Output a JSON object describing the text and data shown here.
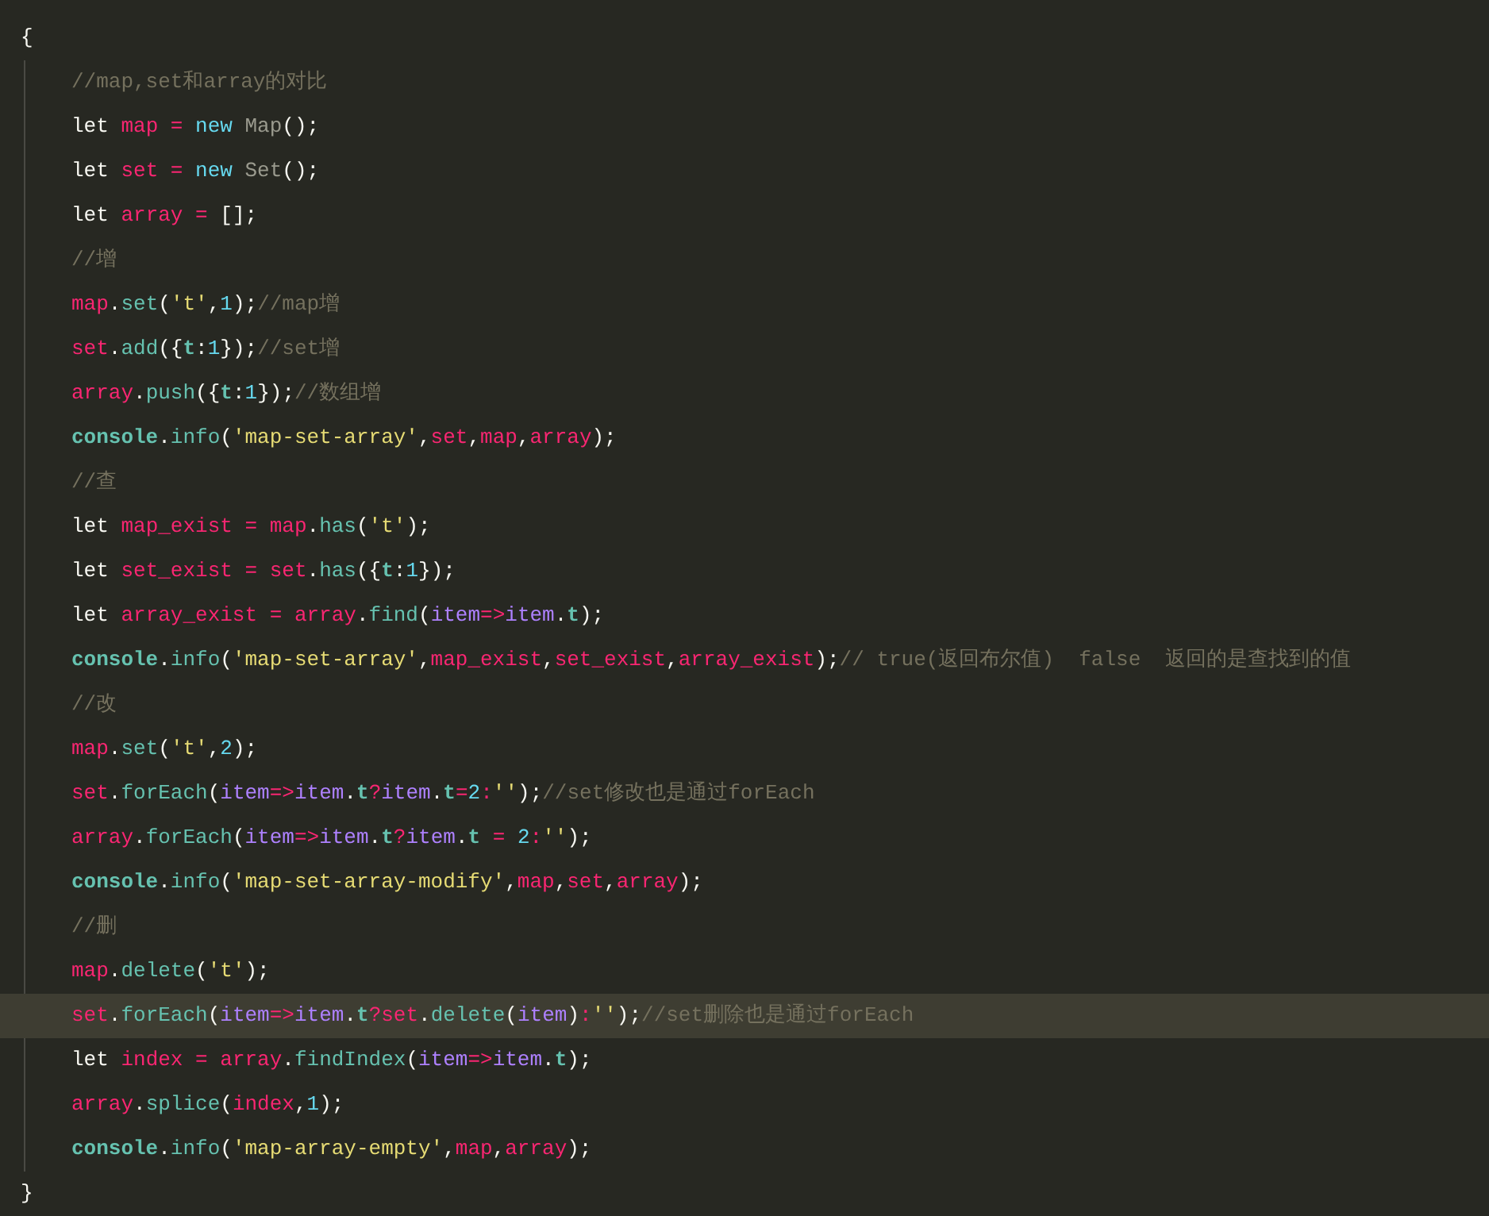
{
  "editor": {
    "lines": [
      {
        "current": false,
        "tokens": [
          {
            "kind": "plain",
            "text": "{"
          }
        ],
        "children": [
          {
            "current": false,
            "tokens": [
              {
                "kind": "comment",
                "text": "//map,set和array的对比"
              }
            ]
          },
          {
            "current": false,
            "tokens": [
              {
                "kind": "plain",
                "text": "let "
              },
              {
                "kind": "var",
                "text": "map"
              },
              {
                "kind": "op",
                "text": " = "
              },
              {
                "kind": "kw",
                "text": "new "
              },
              {
                "kind": "cls",
                "text": "Map"
              },
              {
                "kind": "plain",
                "text": "();"
              }
            ]
          },
          {
            "current": false,
            "tokens": [
              {
                "kind": "plain",
                "text": "let "
              },
              {
                "kind": "var",
                "text": "set"
              },
              {
                "kind": "op",
                "text": " = "
              },
              {
                "kind": "kw",
                "text": "new "
              },
              {
                "kind": "cls",
                "text": "Set"
              },
              {
                "kind": "plain",
                "text": "();"
              }
            ]
          },
          {
            "current": false,
            "tokens": [
              {
                "kind": "plain",
                "text": "let "
              },
              {
                "kind": "var",
                "text": "array"
              },
              {
                "kind": "op",
                "text": " = "
              },
              {
                "kind": "plain",
                "text": "[];"
              }
            ]
          },
          {
            "current": false,
            "tokens": [
              {
                "kind": "comment",
                "text": "//增"
              }
            ]
          },
          {
            "current": false,
            "tokens": [
              {
                "kind": "var",
                "text": "map"
              },
              {
                "kind": "plain",
                "text": "."
              },
              {
                "kind": "fn",
                "text": "set"
              },
              {
                "kind": "plain",
                "text": "("
              },
              {
                "kind": "str",
                "text": "'t'"
              },
              {
                "kind": "plain",
                "text": ","
              },
              {
                "kind": "num",
                "text": "1"
              },
              {
                "kind": "plain",
                "text": ");"
              },
              {
                "kind": "comment",
                "text": "//map增"
              }
            ]
          },
          {
            "current": false,
            "tokens": [
              {
                "kind": "var",
                "text": "set"
              },
              {
                "kind": "plain",
                "text": "."
              },
              {
                "kind": "fn",
                "text": "add"
              },
              {
                "kind": "plain",
                "text": "({"
              },
              {
                "kind": "key",
                "text": "t"
              },
              {
                "kind": "plain",
                "text": ":"
              },
              {
                "kind": "num",
                "text": "1"
              },
              {
                "kind": "plain",
                "text": "});"
              },
              {
                "kind": "comment",
                "text": "//set增"
              }
            ]
          },
          {
            "current": false,
            "tokens": [
              {
                "kind": "var",
                "text": "array"
              },
              {
                "kind": "plain",
                "text": "."
              },
              {
                "kind": "fn",
                "text": "push"
              },
              {
                "kind": "plain",
                "text": "({"
              },
              {
                "kind": "key",
                "text": "t"
              },
              {
                "kind": "plain",
                "text": ":"
              },
              {
                "kind": "num",
                "text": "1"
              },
              {
                "kind": "plain",
                "text": "});"
              },
              {
                "kind": "comment",
                "text": "//数组增"
              }
            ]
          },
          {
            "current": false,
            "tokens": [
              {
                "kind": "key",
                "text": "console"
              },
              {
                "kind": "plain",
                "text": "."
              },
              {
                "kind": "fn",
                "text": "info"
              },
              {
                "kind": "plain",
                "text": "("
              },
              {
                "kind": "str",
                "text": "'map-set-array'"
              },
              {
                "kind": "plain",
                "text": ","
              },
              {
                "kind": "var",
                "text": "set"
              },
              {
                "kind": "plain",
                "text": ","
              },
              {
                "kind": "var",
                "text": "map"
              },
              {
                "kind": "plain",
                "text": ","
              },
              {
                "kind": "var",
                "text": "array"
              },
              {
                "kind": "plain",
                "text": ");"
              }
            ]
          },
          {
            "current": false,
            "tokens": [
              {
                "kind": "comment",
                "text": "//查"
              }
            ]
          },
          {
            "current": false,
            "tokens": [
              {
                "kind": "plain",
                "text": "let "
              },
              {
                "kind": "var",
                "text": "map_exist"
              },
              {
                "kind": "op",
                "text": " = "
              },
              {
                "kind": "var",
                "text": "map"
              },
              {
                "kind": "plain",
                "text": "."
              },
              {
                "kind": "fn",
                "text": "has"
              },
              {
                "kind": "plain",
                "text": "("
              },
              {
                "kind": "str",
                "text": "'t'"
              },
              {
                "kind": "plain",
                "text": ");"
              }
            ]
          },
          {
            "current": false,
            "tokens": [
              {
                "kind": "plain",
                "text": "let "
              },
              {
                "kind": "var",
                "text": "set_exist"
              },
              {
                "kind": "op",
                "text": " = "
              },
              {
                "kind": "var",
                "text": "set"
              },
              {
                "kind": "plain",
                "text": "."
              },
              {
                "kind": "fn",
                "text": "has"
              },
              {
                "kind": "plain",
                "text": "({"
              },
              {
                "kind": "key",
                "text": "t"
              },
              {
                "kind": "plain",
                "text": ":"
              },
              {
                "kind": "num",
                "text": "1"
              },
              {
                "kind": "plain",
                "text": "});"
              }
            ]
          },
          {
            "current": false,
            "tokens": [
              {
                "kind": "plain",
                "text": "let "
              },
              {
                "kind": "var",
                "text": "array_exist"
              },
              {
                "kind": "op",
                "text": " = "
              },
              {
                "kind": "var",
                "text": "array"
              },
              {
                "kind": "plain",
                "text": "."
              },
              {
                "kind": "fn",
                "text": "find"
              },
              {
                "kind": "plain",
                "text": "("
              },
              {
                "kind": "prop",
                "text": "item"
              },
              {
                "kind": "op",
                "text": "=>"
              },
              {
                "kind": "prop",
                "text": "item"
              },
              {
                "kind": "plain",
                "text": "."
              },
              {
                "kind": "key",
                "text": "t"
              },
              {
                "kind": "plain",
                "text": ");"
              }
            ]
          },
          {
            "current": false,
            "tokens": [
              {
                "kind": "key",
                "text": "console"
              },
              {
                "kind": "plain",
                "text": "."
              },
              {
                "kind": "fn",
                "text": "info"
              },
              {
                "kind": "plain",
                "text": "("
              },
              {
                "kind": "str",
                "text": "'map-set-array'"
              },
              {
                "kind": "plain",
                "text": ","
              },
              {
                "kind": "var",
                "text": "map_exist"
              },
              {
                "kind": "plain",
                "text": ","
              },
              {
                "kind": "var",
                "text": "set_exist"
              },
              {
                "kind": "plain",
                "text": ","
              },
              {
                "kind": "var",
                "text": "array_exist"
              },
              {
                "kind": "plain",
                "text": ");"
              },
              {
                "kind": "comment",
                "text": "// true(返回布尔值)  false  返回的是查找到的值"
              }
            ]
          },
          {
            "current": false,
            "tokens": [
              {
                "kind": "comment",
                "text": "//改"
              }
            ]
          },
          {
            "current": false,
            "tokens": [
              {
                "kind": "var",
                "text": "map"
              },
              {
                "kind": "plain",
                "text": "."
              },
              {
                "kind": "fn",
                "text": "set"
              },
              {
                "kind": "plain",
                "text": "("
              },
              {
                "kind": "str",
                "text": "'t'"
              },
              {
                "kind": "plain",
                "text": ","
              },
              {
                "kind": "num",
                "text": "2"
              },
              {
                "kind": "plain",
                "text": ");"
              }
            ]
          },
          {
            "current": false,
            "tokens": [
              {
                "kind": "var",
                "text": "set"
              },
              {
                "kind": "plain",
                "text": "."
              },
              {
                "kind": "fn",
                "text": "forEach"
              },
              {
                "kind": "plain",
                "text": "("
              },
              {
                "kind": "prop",
                "text": "item"
              },
              {
                "kind": "op",
                "text": "=>"
              },
              {
                "kind": "prop",
                "text": "item"
              },
              {
                "kind": "plain",
                "text": "."
              },
              {
                "kind": "key",
                "text": "t"
              },
              {
                "kind": "op",
                "text": "?"
              },
              {
                "kind": "prop",
                "text": "item"
              },
              {
                "kind": "plain",
                "text": "."
              },
              {
                "kind": "key",
                "text": "t"
              },
              {
                "kind": "op",
                "text": "="
              },
              {
                "kind": "num",
                "text": "2"
              },
              {
                "kind": "op",
                "text": ":"
              },
              {
                "kind": "str",
                "text": "''"
              },
              {
                "kind": "plain",
                "text": ");"
              },
              {
                "kind": "comment",
                "text": "//set修改也是通过forEach"
              }
            ]
          },
          {
            "current": false,
            "tokens": [
              {
                "kind": "var",
                "text": "array"
              },
              {
                "kind": "plain",
                "text": "."
              },
              {
                "kind": "fn",
                "text": "forEach"
              },
              {
                "kind": "plain",
                "text": "("
              },
              {
                "kind": "prop",
                "text": "item"
              },
              {
                "kind": "op",
                "text": "=>"
              },
              {
                "kind": "prop",
                "text": "item"
              },
              {
                "kind": "plain",
                "text": "."
              },
              {
                "kind": "key",
                "text": "t"
              },
              {
                "kind": "op",
                "text": "?"
              },
              {
                "kind": "prop",
                "text": "item"
              },
              {
                "kind": "plain",
                "text": "."
              },
              {
                "kind": "key",
                "text": "t"
              },
              {
                "kind": "op",
                "text": " = "
              },
              {
                "kind": "num",
                "text": "2"
              },
              {
                "kind": "op",
                "text": ":"
              },
              {
                "kind": "str",
                "text": "''"
              },
              {
                "kind": "plain",
                "text": ");"
              }
            ]
          },
          {
            "current": false,
            "tokens": [
              {
                "kind": "key",
                "text": "console"
              },
              {
                "kind": "plain",
                "text": "."
              },
              {
                "kind": "fn",
                "text": "info"
              },
              {
                "kind": "plain",
                "text": "("
              },
              {
                "kind": "str",
                "text": "'map-set-array-modify'"
              },
              {
                "kind": "plain",
                "text": ","
              },
              {
                "kind": "var",
                "text": "map"
              },
              {
                "kind": "plain",
                "text": ","
              },
              {
                "kind": "var",
                "text": "set"
              },
              {
                "kind": "plain",
                "text": ","
              },
              {
                "kind": "var",
                "text": "array"
              },
              {
                "kind": "plain",
                "text": ");"
              }
            ]
          },
          {
            "current": false,
            "tokens": [
              {
                "kind": "comment",
                "text": "//删"
              }
            ]
          },
          {
            "current": false,
            "tokens": [
              {
                "kind": "var",
                "text": "map"
              },
              {
                "kind": "plain",
                "text": "."
              },
              {
                "kind": "fn",
                "text": "delete"
              },
              {
                "kind": "plain",
                "text": "("
              },
              {
                "kind": "str",
                "text": "'t'"
              },
              {
                "kind": "plain",
                "text": ");"
              }
            ]
          },
          {
            "current": true,
            "tokens": [
              {
                "kind": "var",
                "text": "set"
              },
              {
                "kind": "plain",
                "text": "."
              },
              {
                "kind": "fn",
                "text": "forEach"
              },
              {
                "kind": "plain",
                "text": "("
              },
              {
                "kind": "prop",
                "text": "item"
              },
              {
                "kind": "op",
                "text": "=>"
              },
              {
                "kind": "prop",
                "text": "item"
              },
              {
                "kind": "plain",
                "text": "."
              },
              {
                "kind": "key",
                "text": "t"
              },
              {
                "kind": "op",
                "text": "?"
              },
              {
                "kind": "var",
                "text": "set"
              },
              {
                "kind": "plain",
                "text": "."
              },
              {
                "kind": "fn",
                "text": "delete"
              },
              {
                "kind": "plain",
                "text": "("
              },
              {
                "kind": "prop",
                "text": "item"
              },
              {
                "kind": "plain",
                "text": ")"
              },
              {
                "kind": "op",
                "text": ":"
              },
              {
                "kind": "str",
                "text": "''"
              },
              {
                "kind": "plain",
                "text": ");"
              },
              {
                "kind": "comment",
                "text": "//set删除也是通过forEach"
              }
            ]
          },
          {
            "current": false,
            "tokens": [
              {
                "kind": "plain",
                "text": "let "
              },
              {
                "kind": "var",
                "text": "index"
              },
              {
                "kind": "op",
                "text": " = "
              },
              {
                "kind": "var",
                "text": "array"
              },
              {
                "kind": "plain",
                "text": "."
              },
              {
                "kind": "fn",
                "text": "findIndex"
              },
              {
                "kind": "plain",
                "text": "("
              },
              {
                "kind": "prop",
                "text": "item"
              },
              {
                "kind": "op",
                "text": "=>"
              },
              {
                "kind": "prop",
                "text": "item"
              },
              {
                "kind": "plain",
                "text": "."
              },
              {
                "kind": "key",
                "text": "t"
              },
              {
                "kind": "plain",
                "text": ");"
              }
            ]
          },
          {
            "current": false,
            "tokens": [
              {
                "kind": "var",
                "text": "array"
              },
              {
                "kind": "plain",
                "text": "."
              },
              {
                "kind": "fn",
                "text": "splice"
              },
              {
                "kind": "plain",
                "text": "("
              },
              {
                "kind": "var",
                "text": "index"
              },
              {
                "kind": "plain",
                "text": ","
              },
              {
                "kind": "num",
                "text": "1"
              },
              {
                "kind": "plain",
                "text": ");"
              }
            ]
          },
          {
            "current": false,
            "tokens": [
              {
                "kind": "key",
                "text": "console"
              },
              {
                "kind": "plain",
                "text": "."
              },
              {
                "kind": "fn",
                "text": "info"
              },
              {
                "kind": "plain",
                "text": "("
              },
              {
                "kind": "str",
                "text": "'map-array-empty'"
              },
              {
                "kind": "plain",
                "text": ","
              },
              {
                "kind": "var",
                "text": "map"
              },
              {
                "kind": "plain",
                "text": ","
              },
              {
                "kind": "var",
                "text": "array"
              },
              {
                "kind": "plain",
                "text": ");"
              }
            ]
          }
        ]
      },
      {
        "current": false,
        "tokens": [
          {
            "kind": "plain",
            "text": "}"
          }
        ]
      }
    ]
  }
}
